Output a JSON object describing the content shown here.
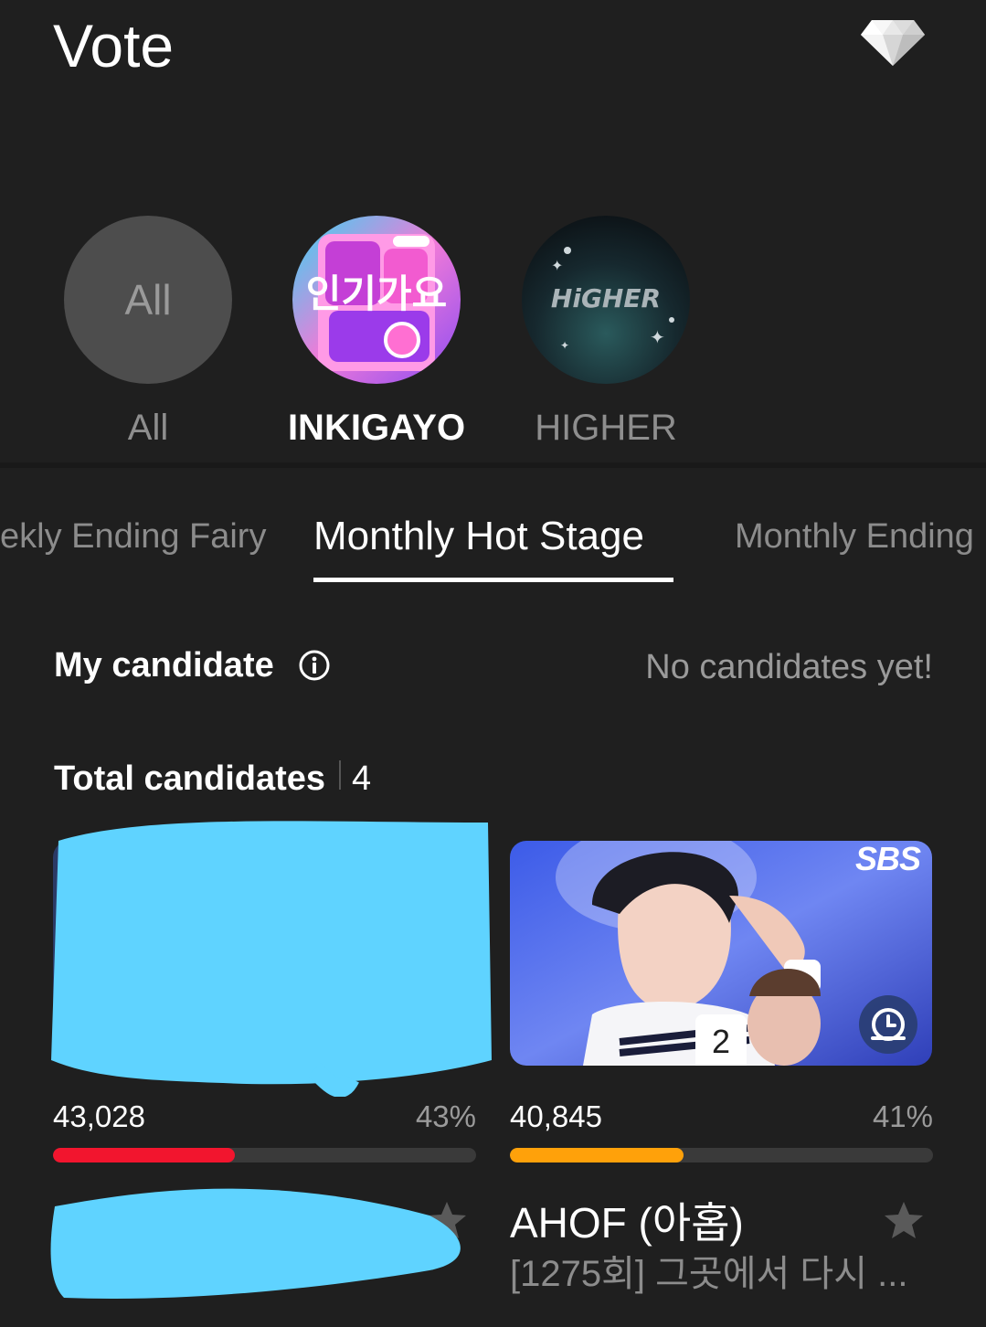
{
  "header": {
    "title": "Vote",
    "icon": "diamond-icon"
  },
  "programs": [
    {
      "circle_text": "All",
      "label": "All",
      "active": false
    },
    {
      "label": "INKIGAYO",
      "active": true,
      "logo_text": "인기가요"
    },
    {
      "label": "HIGHER",
      "active": false,
      "logo_text": "HiGHER"
    }
  ],
  "tabs": [
    {
      "label": "ekly Ending Fairy",
      "active": false
    },
    {
      "label": "Monthly Hot Stage",
      "active": true
    },
    {
      "label": "Monthly Ending F",
      "active": false
    }
  ],
  "my_candidate": {
    "label": "My candidate",
    "empty_text": "No candidates yet!"
  },
  "total": {
    "label": "Total candidates",
    "count": "4"
  },
  "candidates": [
    {
      "votes": "43,028",
      "percent_text": "43%",
      "progress": 0.43,
      "bar_color": "#f2152e",
      "artist": "",
      "song": "",
      "redacted": true
    },
    {
      "votes": "40,845",
      "percent_text": "41%",
      "progress": 0.41,
      "bar_color": "#ffa10a",
      "artist": "AHOF (아홉)",
      "song": "[1275회] 그곳에서 다시 ...",
      "rank": "2",
      "broadcaster": "SBS",
      "redacted": false
    }
  ],
  "colors": {
    "background": "#1f1f1f",
    "redaction": "#5fd3ff",
    "bar_track": "#3a3a3a"
  }
}
